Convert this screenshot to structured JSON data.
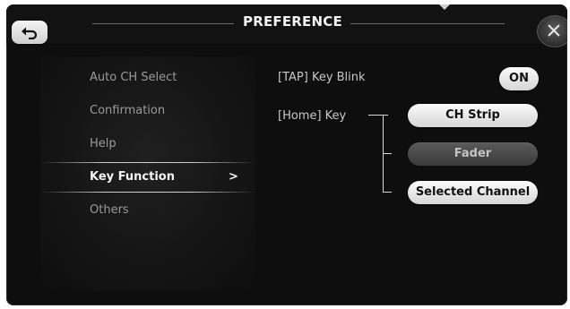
{
  "window": {
    "title": "PREFERENCE"
  },
  "sidebar": {
    "items": [
      {
        "label": "Auto CH Select",
        "selected": false
      },
      {
        "label": "Confirmation",
        "selected": false
      },
      {
        "label": "Help",
        "selected": false
      },
      {
        "label": "Key Function",
        "selected": true,
        "indicator": ">"
      },
      {
        "label": "Others",
        "selected": false
      }
    ]
  },
  "key_function": {
    "tap_key_blink": {
      "label": "[TAP] Key Blink",
      "toggle": "ON"
    },
    "home_key": {
      "label": "[Home] Key",
      "options": [
        {
          "label": "CH Strip",
          "active": true
        },
        {
          "label": "Fader",
          "active": false
        },
        {
          "label": "Selected Channel",
          "active": true
        }
      ]
    }
  },
  "icons": {
    "back": "back-arrow-icon",
    "close": "close-icon"
  }
}
